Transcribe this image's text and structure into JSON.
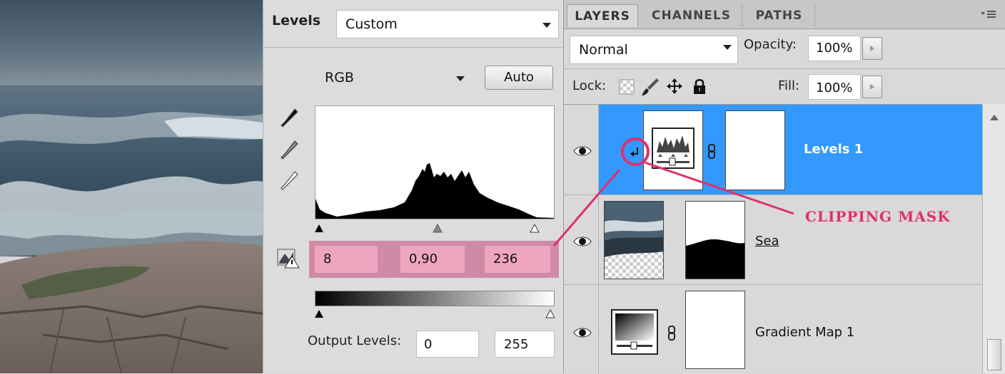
{
  "levels": {
    "title": "Levels",
    "preset": "Custom",
    "channel": "RGB",
    "auto_label": "Auto",
    "input_black": "8",
    "input_gamma": "0,90",
    "input_white": "236",
    "output_label": "Output Levels:",
    "output_black": "0",
    "output_white": "255"
  },
  "layers_panel": {
    "tabs": [
      "LAYERS",
      "CHANNELS",
      "PATHS"
    ],
    "blend_mode": "Normal",
    "opacity_label": "Opacity:",
    "opacity_value": "100%",
    "lock_label": "Lock:",
    "fill_label": "Fill:",
    "fill_value": "100%",
    "layers": [
      {
        "name": "Levels 1",
        "selected": true
      },
      {
        "name": "Sea",
        "selected": false
      },
      {
        "name": "Gradient Map 1",
        "selected": false
      }
    ]
  },
  "annotation": {
    "label": "CLIPPING MASK",
    "color": "#e0306e"
  },
  "colors": {
    "selection": "#3399ff",
    "pink_field": "#eea5bf",
    "input_row_bg": "#cf8ba6"
  },
  "icons": [
    "eyedropper-black-icon",
    "eyedropper-gray-icon",
    "eyedropper-white-icon",
    "clipping-warning-icon",
    "eye-icon",
    "link-chain-icon",
    "lock-transparent-icon",
    "lock-brush-icon",
    "lock-move-icon",
    "lock-all-icon",
    "panel-menu-icon",
    "scroll-up-icon"
  ]
}
